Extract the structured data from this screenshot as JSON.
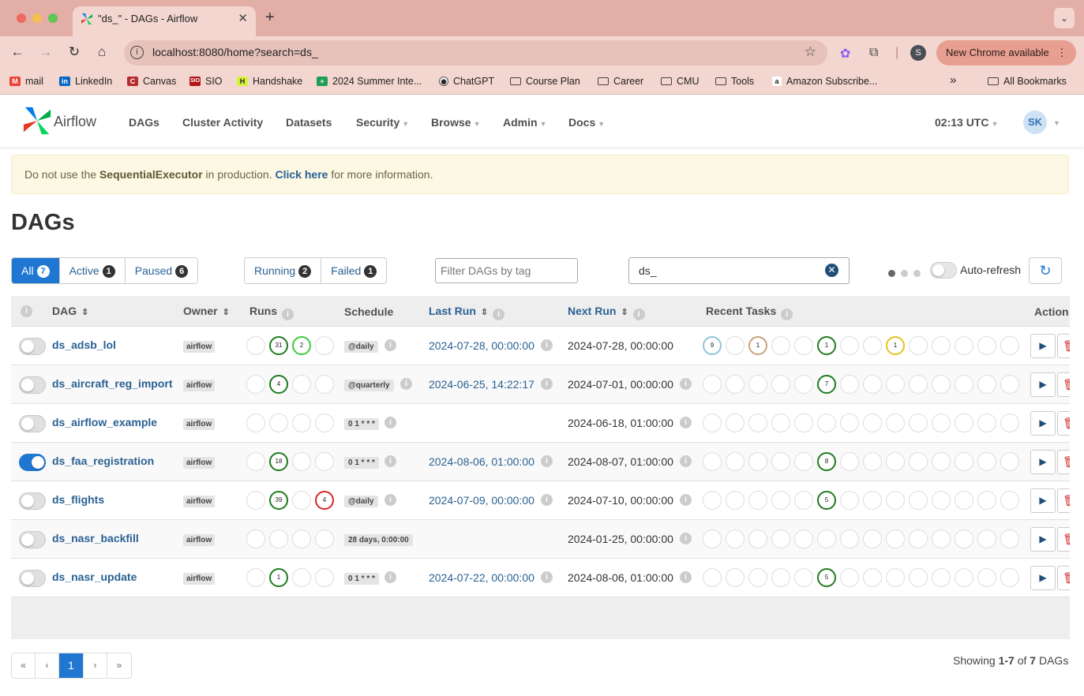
{
  "browser": {
    "tab_title": "\"ds_\" - DAGs - Airflow",
    "url": "localhost:8080/home?search=ds_",
    "profile_initial": "S",
    "update_label": "New Chrome available",
    "bookmarks": [
      "mail",
      "LinkedIn",
      "Canvas",
      "SIO",
      "Handshake",
      "2024 Summer Inte...",
      "ChatGPT",
      "Course Plan",
      "Career",
      "CMU",
      "Tools",
      "Amazon Subscribe..."
    ],
    "all_bookmarks": "All Bookmarks",
    "overflow": "»"
  },
  "nav": {
    "brand": "Airflow",
    "items": [
      "DAGs",
      "Cluster Activity",
      "Datasets",
      "Security",
      "Browse",
      "Admin",
      "Docs"
    ],
    "time": "02:13 UTC",
    "user_initials": "SK"
  },
  "alert": {
    "prefix": "Do not use the ",
    "executor": "SequentialExecutor",
    "middle": " in production. ",
    "link": "Click here",
    "suffix": " for more information."
  },
  "page_title": "DAGs",
  "filters": {
    "status": [
      {
        "label": "All",
        "count": "7"
      },
      {
        "label": "Active",
        "count": "1"
      },
      {
        "label": "Paused",
        "count": "6"
      }
    ],
    "runs": [
      {
        "label": "Running",
        "count": "2"
      },
      {
        "label": "Failed",
        "count": "1"
      }
    ],
    "tag_placeholder": "Filter DAGs by tag",
    "search_value": "ds_",
    "autorefresh_label": "Auto-refresh"
  },
  "table": {
    "headers": {
      "dag": "DAG",
      "owner": "Owner",
      "runs": "Runs",
      "schedule": "Schedule",
      "last_run": "Last Run",
      "next_run": "Next Run",
      "recent_tasks": "Recent Tasks",
      "actions": "Action"
    },
    "rows": [
      {
        "dag_id": "ds_adsb_lol",
        "active": false,
        "owner": "airflow",
        "runs": [
          "",
          "31",
          "2",
          ""
        ],
        "run_colors": [
          "#ddd",
          "#1e7b1e",
          "#3ec93e",
          "#ddd"
        ],
        "schedule": "@daily",
        "last_run": "2024-07-28, 00:00:00",
        "next_run": "2024-07-28, 00:00:00",
        "tasks": [
          "9",
          "",
          "1",
          "",
          "",
          "1",
          "",
          "",
          "1",
          "",
          "",
          "",
          "",
          ""
        ],
        "task_colors": [
          "#8fc5d8",
          "#ddd",
          "#c9a27a",
          "#ddd",
          "#ddd",
          "#1e7b1e",
          "#ddd",
          "#ddd",
          "#e6c21f",
          "#ddd",
          "#ddd",
          "#ddd",
          "#ddd",
          "#ddd"
        ]
      },
      {
        "dag_id": "ds_aircraft_reg_import",
        "active": false,
        "owner": "airflow",
        "runs": [
          "",
          "4",
          "",
          ""
        ],
        "run_colors": [
          "#ddd",
          "#1e7b1e",
          "#ddd",
          "#ddd"
        ],
        "schedule": "@quarterly",
        "last_run": "2024-06-25, 14:22:17",
        "next_run": "2024-07-01, 00:00:00",
        "tasks": [
          "",
          "",
          "",
          "",
          "",
          "7",
          "",
          "",
          "",
          "",
          "",
          "",
          "",
          ""
        ],
        "task_colors": [
          "#ddd",
          "#ddd",
          "#ddd",
          "#ddd",
          "#ddd",
          "#1e7b1e",
          "#ddd",
          "#ddd",
          "#ddd",
          "#ddd",
          "#ddd",
          "#ddd",
          "#ddd",
          "#ddd"
        ]
      },
      {
        "dag_id": "ds_airflow_example",
        "active": false,
        "owner": "airflow",
        "runs": [
          "",
          "",
          "",
          ""
        ],
        "run_colors": [
          "#ddd",
          "#ddd",
          "#ddd",
          "#ddd"
        ],
        "schedule": "0 1 * * *",
        "last_run": "",
        "next_run": "2024-06-18, 01:00:00",
        "tasks": [
          "",
          "",
          "",
          "",
          "",
          "",
          "",
          "",
          "",
          "",
          "",
          "",
          "",
          ""
        ],
        "task_colors": [
          "#ddd",
          "#ddd",
          "#ddd",
          "#ddd",
          "#ddd",
          "#ddd",
          "#ddd",
          "#ddd",
          "#ddd",
          "#ddd",
          "#ddd",
          "#ddd",
          "#ddd",
          "#ddd"
        ]
      },
      {
        "dag_id": "ds_faa_registration",
        "active": true,
        "owner": "airflow",
        "runs": [
          "",
          "18",
          "",
          ""
        ],
        "run_colors": [
          "#ddd",
          "#1e7b1e",
          "#ddd",
          "#ddd"
        ],
        "schedule": "0 1 * * *",
        "last_run": "2024-08-06, 01:00:00",
        "next_run": "2024-08-07, 01:00:00",
        "tasks": [
          "",
          "",
          "",
          "",
          "",
          "8",
          "",
          "",
          "",
          "",
          "",
          "",
          "",
          ""
        ],
        "task_colors": [
          "#ddd",
          "#ddd",
          "#ddd",
          "#ddd",
          "#ddd",
          "#1e7b1e",
          "#ddd",
          "#ddd",
          "#ddd",
          "#ddd",
          "#ddd",
          "#ddd",
          "#ddd",
          "#ddd"
        ]
      },
      {
        "dag_id": "ds_flights",
        "active": false,
        "owner": "airflow",
        "runs": [
          "",
          "39",
          "",
          "4"
        ],
        "run_colors": [
          "#ddd",
          "#1e7b1e",
          "#ddd",
          "#d62728"
        ],
        "schedule": "@daily",
        "last_run": "2024-07-09, 00:00:00",
        "next_run": "2024-07-10, 00:00:00",
        "tasks": [
          "",
          "",
          "",
          "",
          "",
          "5",
          "",
          "",
          "",
          "",
          "",
          "",
          "",
          ""
        ],
        "task_colors": [
          "#ddd",
          "#ddd",
          "#ddd",
          "#ddd",
          "#ddd",
          "#1e7b1e",
          "#ddd",
          "#ddd",
          "#ddd",
          "#ddd",
          "#ddd",
          "#ddd",
          "#ddd",
          "#ddd"
        ]
      },
      {
        "dag_id": "ds_nasr_backfill",
        "active": false,
        "owner": "airflow",
        "runs": [
          "",
          "",
          "",
          ""
        ],
        "run_colors": [
          "#ddd",
          "#ddd",
          "#ddd",
          "#ddd"
        ],
        "schedule": "28 days, 0:00:00",
        "last_run": "",
        "next_run": "2024-01-25, 00:00:00",
        "tasks": [
          "",
          "",
          "",
          "",
          "",
          "",
          "",
          "",
          "",
          "",
          "",
          "",
          "",
          ""
        ],
        "task_colors": [
          "#ddd",
          "#ddd",
          "#ddd",
          "#ddd",
          "#ddd",
          "#ddd",
          "#ddd",
          "#ddd",
          "#ddd",
          "#ddd",
          "#ddd",
          "#ddd",
          "#ddd",
          "#ddd"
        ]
      },
      {
        "dag_id": "ds_nasr_update",
        "active": false,
        "owner": "airflow",
        "runs": [
          "",
          "1",
          "",
          ""
        ],
        "run_colors": [
          "#ddd",
          "#1e7b1e",
          "#ddd",
          "#ddd"
        ],
        "schedule": "0 1 * * *",
        "last_run": "2024-07-22, 00:00:00",
        "next_run": "2024-08-06, 01:00:00",
        "tasks": [
          "",
          "",
          "",
          "",
          "",
          "5",
          "",
          "",
          "",
          "",
          "",
          "",
          "",
          ""
        ],
        "task_colors": [
          "#ddd",
          "#ddd",
          "#ddd",
          "#ddd",
          "#ddd",
          "#1e7b1e",
          "#ddd",
          "#ddd",
          "#ddd",
          "#ddd",
          "#ddd",
          "#ddd",
          "#ddd",
          "#ddd"
        ]
      }
    ]
  },
  "pagination": {
    "first": "«",
    "prev": "‹",
    "current": "1",
    "next": "›",
    "last": "»",
    "showing_prefix": "Showing ",
    "showing_range": "1-7",
    "showing_middle": " of ",
    "showing_total": "7",
    "showing_suffix": " DAGs"
  },
  "icons": {
    "back": "arrow-left-icon",
    "forward": "arrow-right-icon",
    "reload": "reload-icon",
    "home": "home-icon",
    "bookmark_star": "star-icon",
    "extensions": "puzzle-icon",
    "trigger": "play-icon",
    "delete": "trash-icon",
    "refresh": "refresh-icon",
    "clear": "clear-icon"
  },
  "colors": {
    "accent": "#1f77d2",
    "link": "#2a6193",
    "success": "#1e7b1e",
    "failed": "#d62728",
    "alert_bg": "#fcf8e3"
  }
}
